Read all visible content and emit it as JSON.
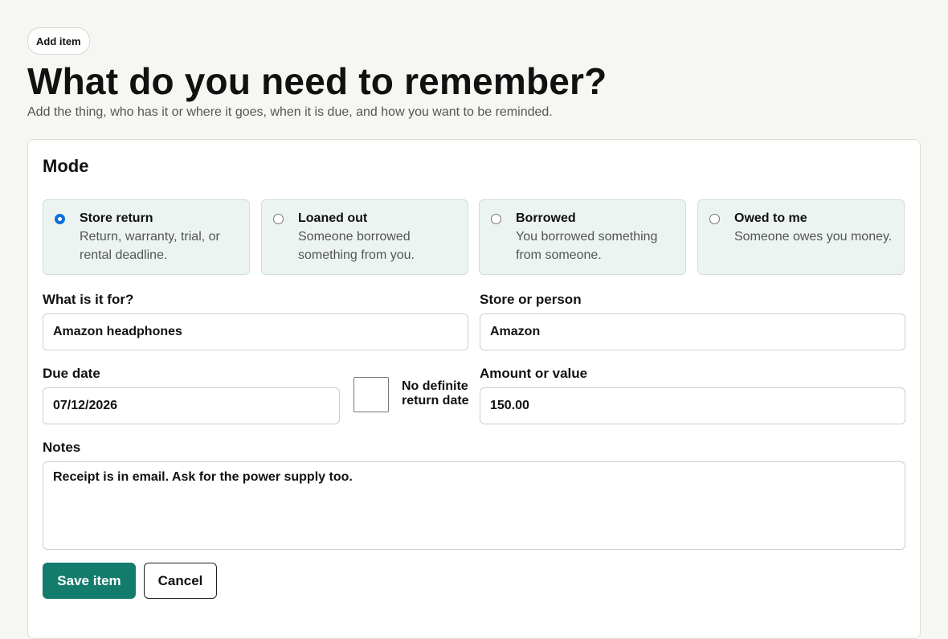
{
  "header": {
    "badge": "Add item",
    "title": "What do you need to remember?",
    "subtitle": "Add the thing, who has it or where it goes, when it is due, and how you want to be reminded."
  },
  "mode": {
    "heading": "Mode",
    "options": [
      {
        "title": "Store return",
        "description": "Return, warranty, trial, or rental deadline.",
        "selected": true
      },
      {
        "title": "Loaned out",
        "description": "Someone borrowed something from you.",
        "selected": false
      },
      {
        "title": "Borrowed",
        "description": "You borrowed something from someone.",
        "selected": false
      },
      {
        "title": "Owed to me",
        "description": "Someone owes you money.",
        "selected": false
      }
    ]
  },
  "fields": {
    "what_label": "What is it for?",
    "what_value": "Amazon headphones",
    "store_label": "Store or person",
    "store_value": "Amazon",
    "due_label": "Due date",
    "due_value": "07/12/2026",
    "no_date_label": "No definite return date",
    "no_date_checked": false,
    "amount_label": "Amount or value",
    "amount_value": "150.00",
    "notes_label": "Notes",
    "notes_value": "Receipt is in email. Ask for the power supply too."
  },
  "actions": {
    "save_label": "Save item",
    "cancel_label": "Cancel"
  },
  "colors": {
    "accent": "#137c6c",
    "option_bg": "#ecf4f1",
    "radio_selected": "#0b6edc"
  }
}
